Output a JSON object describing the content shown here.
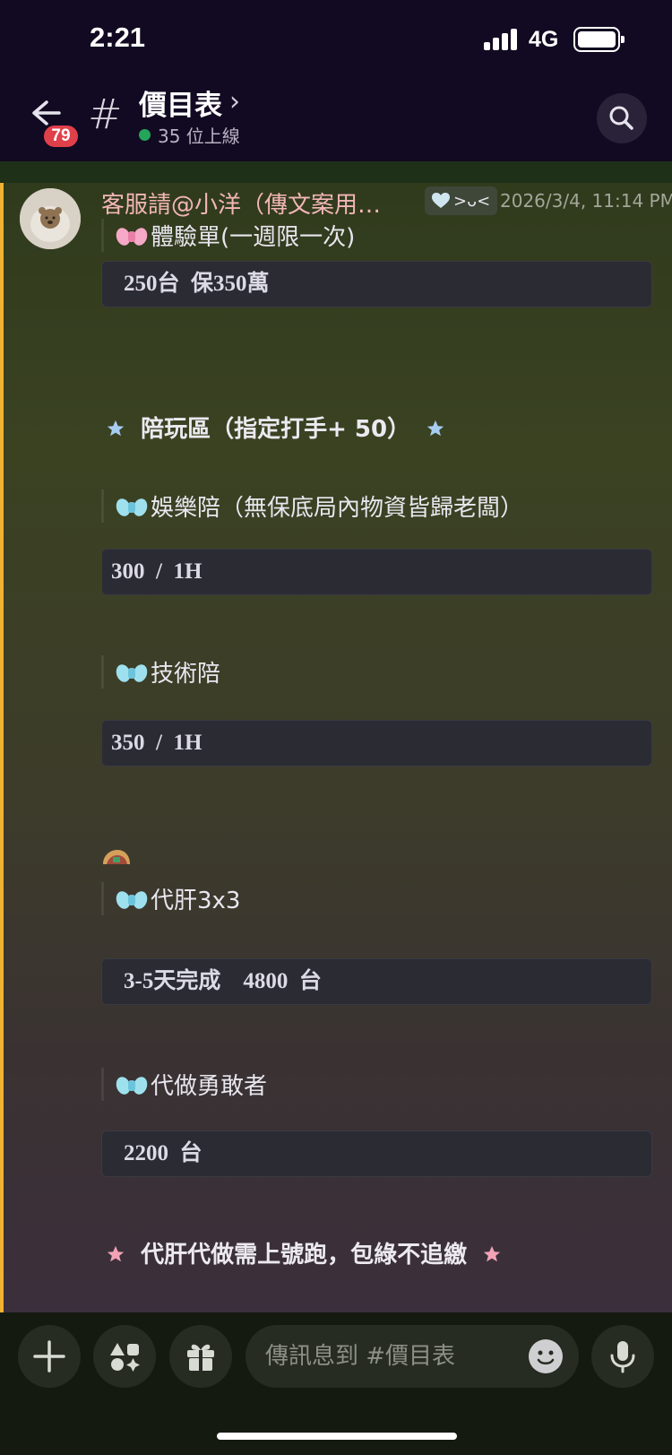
{
  "status_bar": {
    "time": "2:21",
    "network": "4G"
  },
  "header": {
    "back_badge": "79",
    "channel_name": "價目表",
    "online_count": "35 位上線"
  },
  "message": {
    "username": "客服請@小洋（傳文案用…",
    "role_tag": ">ᴗ<",
    "timestamp": "2026/3/4, 11:14 PM",
    "trial_label": "體驗單(一週限一次)",
    "trial_price": "250台  保350萬",
    "section_title": "陪玩區（指定打手+ 50）",
    "ent_label": "娛樂陪（無保底局內物資皆歸老闆）",
    "ent_price": "300  /  1H",
    "tech_label": "技術陪",
    "tech_price": "350  /  1H",
    "proxy3_label": "代肝3x3",
    "proxy3_price": "3-5天完成    4800  台",
    "brave_label": "代做勇敢者",
    "brave_price": "2200  台",
    "note": "代肝代做需上號跑，包綠不追繳"
  },
  "composer": {
    "placeholder": "傳訊息到 #價目表"
  },
  "icons": {
    "back": "arrow-left-icon",
    "hash": "hash-icon",
    "search": "search-icon",
    "plus": "plus-icon",
    "apps": "apps-icon",
    "gift": "gift-icon",
    "emoji": "emoji-icon",
    "mic": "microphone-icon"
  },
  "colors": {
    "mention_bar": "#f0b232",
    "online": "#23a55a",
    "badge": "#e0404a",
    "username": "#f3b6b6"
  }
}
